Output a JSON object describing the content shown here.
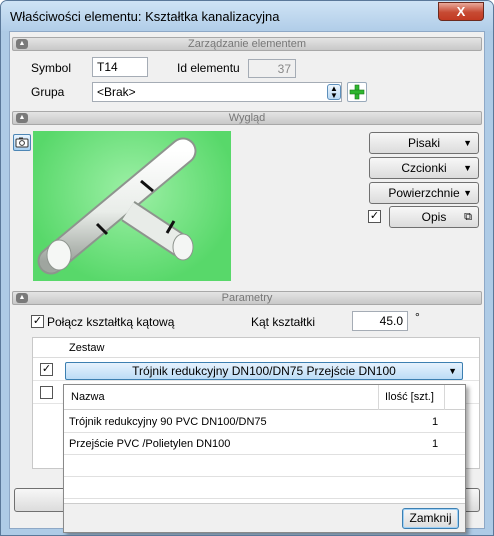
{
  "window": {
    "title": "Właściwości elementu: Kształtka kanalizacyjna",
    "close_label": "X"
  },
  "sections": {
    "management": "Zarządzanie elementem",
    "appearance": "Wygląd",
    "parameters": "Parametry"
  },
  "management": {
    "symbol_label": "Symbol",
    "symbol_value": "T14",
    "id_label": "Id elementu",
    "id_value": "37",
    "group_label": "Grupa",
    "group_value": "<Brak>"
  },
  "appearance": {
    "pens_label": "Pisaki",
    "fonts_label": "Czcionki",
    "surfaces_label": "Powierzchnie",
    "description_label": "Opis",
    "description_checked": true
  },
  "parameters": {
    "connect_label": "Połącz kształtką kątową",
    "connect_checked": true,
    "angle_label": "Kąt kształtki",
    "angle_value": "45.0",
    "angle_unit": "°"
  },
  "set_table": {
    "header": "Zestaw",
    "rows": [
      {
        "checked": true,
        "value": "Trójnik redukcyjny DN100/DN75  Przejście DN100"
      },
      {
        "checked": false,
        "value": ""
      }
    ]
  },
  "popup": {
    "col_name": "Nazwa",
    "col_qty": "Ilość [szt.]",
    "rows": [
      {
        "name": "Trójnik redukcyjny 90 PVC  DN100/DN75",
        "qty": "1"
      },
      {
        "name": "Przejście PVC /Polietylen  DN100",
        "qty": "1"
      }
    ],
    "close_label": "Zamknij"
  },
  "icons": [
    "camera-icon",
    "spin-up-down-icon",
    "add-icon",
    "dropdown-arrow-icon",
    "open-dialog-icon",
    "collapse-chevron-icon"
  ],
  "colors": {
    "title_bar": "#b9d3ec",
    "preview_bg": "#6fe07e",
    "combo_highlight": "#cde6fb",
    "add_icon": "#2fb62f"
  }
}
